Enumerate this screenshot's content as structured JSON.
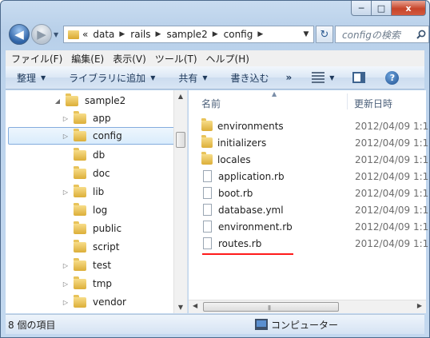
{
  "window": {
    "caption_buttons": {
      "minimize": "─",
      "maximize": "□",
      "close": "x"
    }
  },
  "nav": {
    "back_glyph": "◀",
    "forward_glyph": "▶",
    "recent_glyph": "▼",
    "address_prefix": "«",
    "breadcrumbs": [
      "data",
      "rails",
      "sample2",
      "config"
    ],
    "address_dropdown_glyph": "▼",
    "refresh_glyph": "↻",
    "search_placeholder": "configの検索",
    "search_icon": "search-icon"
  },
  "menubar": [
    "ファイル(F)",
    "編集(E)",
    "表示(V)",
    "ツール(T)",
    "ヘルプ(H)"
  ],
  "cmdbar": {
    "organize": "整理",
    "include_in_library": "ライブラリに追加",
    "share": "共有",
    "burn": "書き込む",
    "more": "»",
    "help": "?"
  },
  "tree": {
    "parent": {
      "label": "sample2",
      "expander": "◢"
    },
    "items": [
      {
        "label": "app",
        "expander": "▷"
      },
      {
        "label": "config",
        "expander": "▷",
        "selected": true
      },
      {
        "label": "db",
        "expander": ""
      },
      {
        "label": "doc",
        "expander": ""
      },
      {
        "label": "lib",
        "expander": "▷"
      },
      {
        "label": "log",
        "expander": ""
      },
      {
        "label": "public",
        "expander": ""
      },
      {
        "label": "script",
        "expander": ""
      },
      {
        "label": "test",
        "expander": "▷"
      },
      {
        "label": "tmp",
        "expander": "▷"
      },
      {
        "label": "vendor",
        "expander": "▷"
      }
    ]
  },
  "columns": {
    "name": "名前",
    "date": "更新日時",
    "sort_glyph": "▲"
  },
  "files": [
    {
      "name": "environments",
      "type": "folder",
      "date": "2012/04/09 1:1"
    },
    {
      "name": "initializers",
      "type": "folder",
      "date": "2012/04/09 1:1"
    },
    {
      "name": "locales",
      "type": "folder",
      "date": "2012/04/09 1:1"
    },
    {
      "name": "application.rb",
      "type": "doc",
      "date": "2012/04/09 1:1"
    },
    {
      "name": "boot.rb",
      "type": "doc",
      "date": "2012/04/09 1:1"
    },
    {
      "name": "database.yml",
      "type": "doc",
      "date": "2012/04/09 1:1"
    },
    {
      "name": "environment.rb",
      "type": "doc",
      "date": "2012/04/09 1:1"
    },
    {
      "name": "routes.rb",
      "type": "doc",
      "date": "2012/04/09 1:1"
    }
  ],
  "scroll": {
    "up": "▲",
    "down": "▼",
    "left": "◀",
    "right": "▶",
    "grip": "|||"
  },
  "status": {
    "item_count": "8 個の項目",
    "location": "コンピューター"
  },
  "colors": {
    "highlight_underline": "#ff1a1a",
    "selection_border": "#84acdd"
  }
}
